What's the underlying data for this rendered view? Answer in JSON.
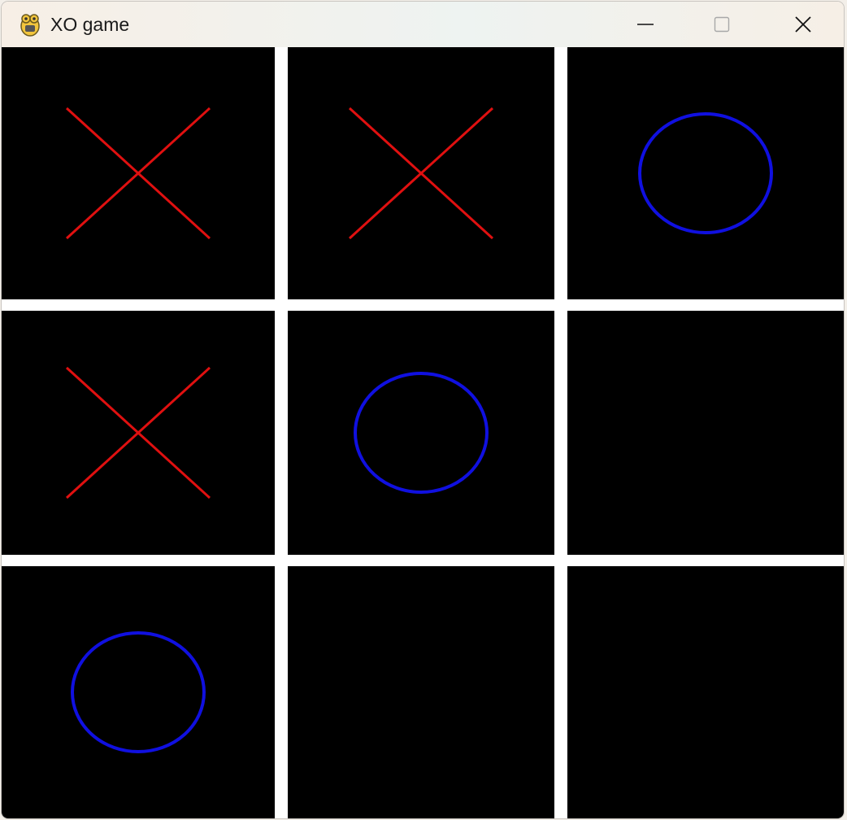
{
  "window": {
    "title": "XO game",
    "icon": "pygame-snake-icon",
    "controls": {
      "minimize": "minimize-icon",
      "maximize": "maximize-icon",
      "close": "close-icon"
    }
  },
  "game": {
    "board": [
      [
        "X",
        "X",
        "O"
      ],
      [
        "X",
        "O",
        ""
      ],
      [
        "O",
        "",
        ""
      ]
    ],
    "colors": {
      "x_mark": "#e01010",
      "o_mark": "#1010e0",
      "cell_background": "#000000",
      "grid_lines": "#ffffff"
    }
  }
}
